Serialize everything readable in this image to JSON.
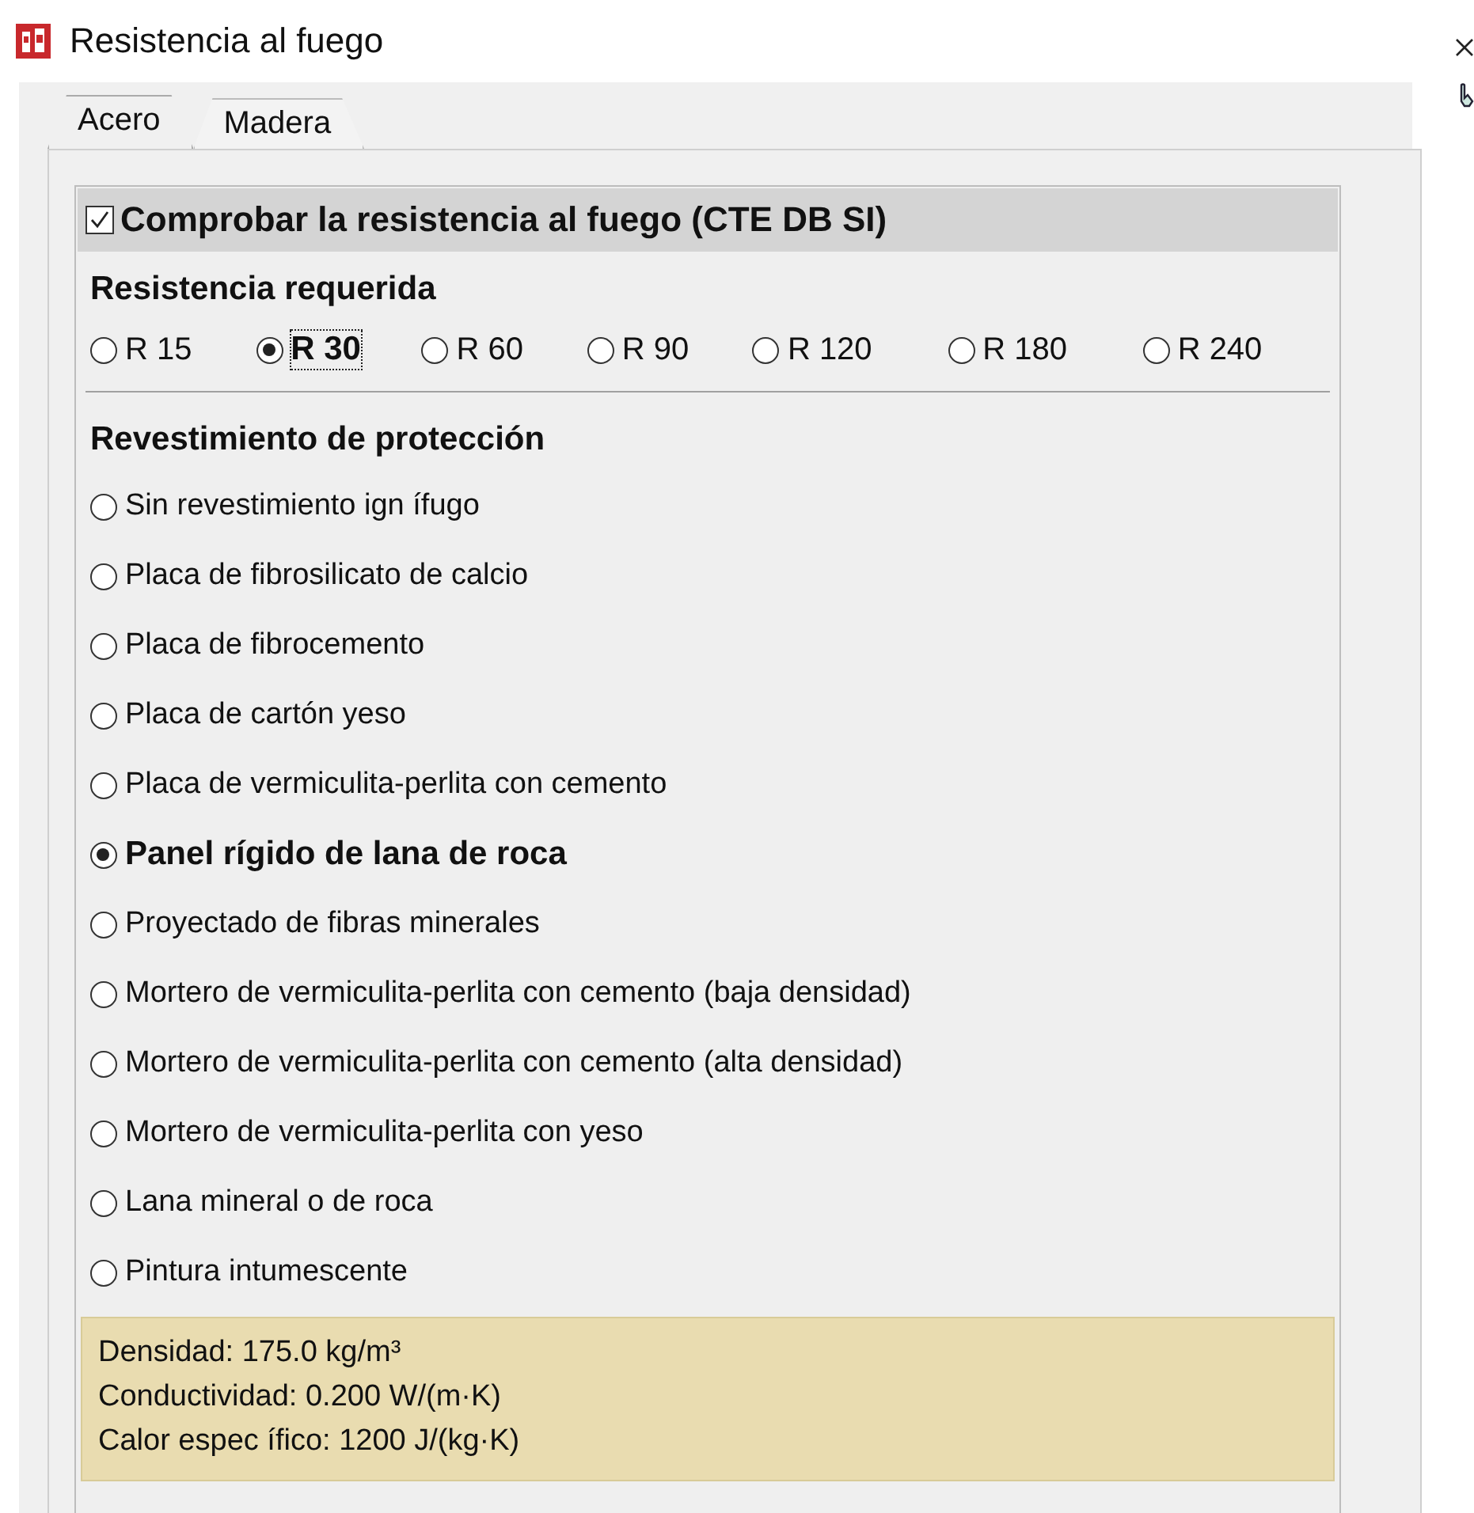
{
  "window": {
    "title": "Resistencia al fuego"
  },
  "tabs": [
    {
      "label": "Acero",
      "selected": true
    },
    {
      "label": "Madera",
      "selected": false
    }
  ],
  "fire_check": {
    "label": "Comprobar la resistencia al fuego (CTE DB SI)",
    "checked": true
  },
  "required": {
    "heading": "Resistencia requerida",
    "options": [
      {
        "label": "R 15",
        "selected": false
      },
      {
        "label": "R 30",
        "selected": true
      },
      {
        "label": "R 60",
        "selected": false
      },
      {
        "label": "R 90",
        "selected": false
      },
      {
        "label": "R 120",
        "selected": false
      },
      {
        "label": "R 180",
        "selected": false
      },
      {
        "label": "R 240",
        "selected": false
      }
    ]
  },
  "coating": {
    "heading": "Revestimiento de protección",
    "options": [
      {
        "label": "Sin revestimiento ign ífugo",
        "selected": false
      },
      {
        "label": "Placa de fibrosilicato de calcio",
        "selected": false
      },
      {
        "label": "Placa de fibrocemento",
        "selected": false
      },
      {
        "label": "Placa de cartón yeso",
        "selected": false
      },
      {
        "label": "Placa de vermiculita-perlita con cemento",
        "selected": false
      },
      {
        "label": "Panel rígido de lana de roca",
        "selected": true
      },
      {
        "label": "Proyectado de fibras minerales",
        "selected": false
      },
      {
        "label": "Mortero de vermiculita-perlita con cemento (baja densidad)",
        "selected": false
      },
      {
        "label": "Mortero de vermiculita-perlita con cemento (alta densidad)",
        "selected": false
      },
      {
        "label": "Mortero de vermiculita-perlita con yeso",
        "selected": false
      },
      {
        "label": "Lana mineral o de roca",
        "selected": false
      },
      {
        "label": "Pintura intumescente",
        "selected": false
      }
    ]
  },
  "properties": [
    "Densidad: 175.0 kg/m³",
    "Conductividad: 0.200 W/(m·K)",
    "Calor espec ífico: 1200 J/(kg·K)"
  ]
}
